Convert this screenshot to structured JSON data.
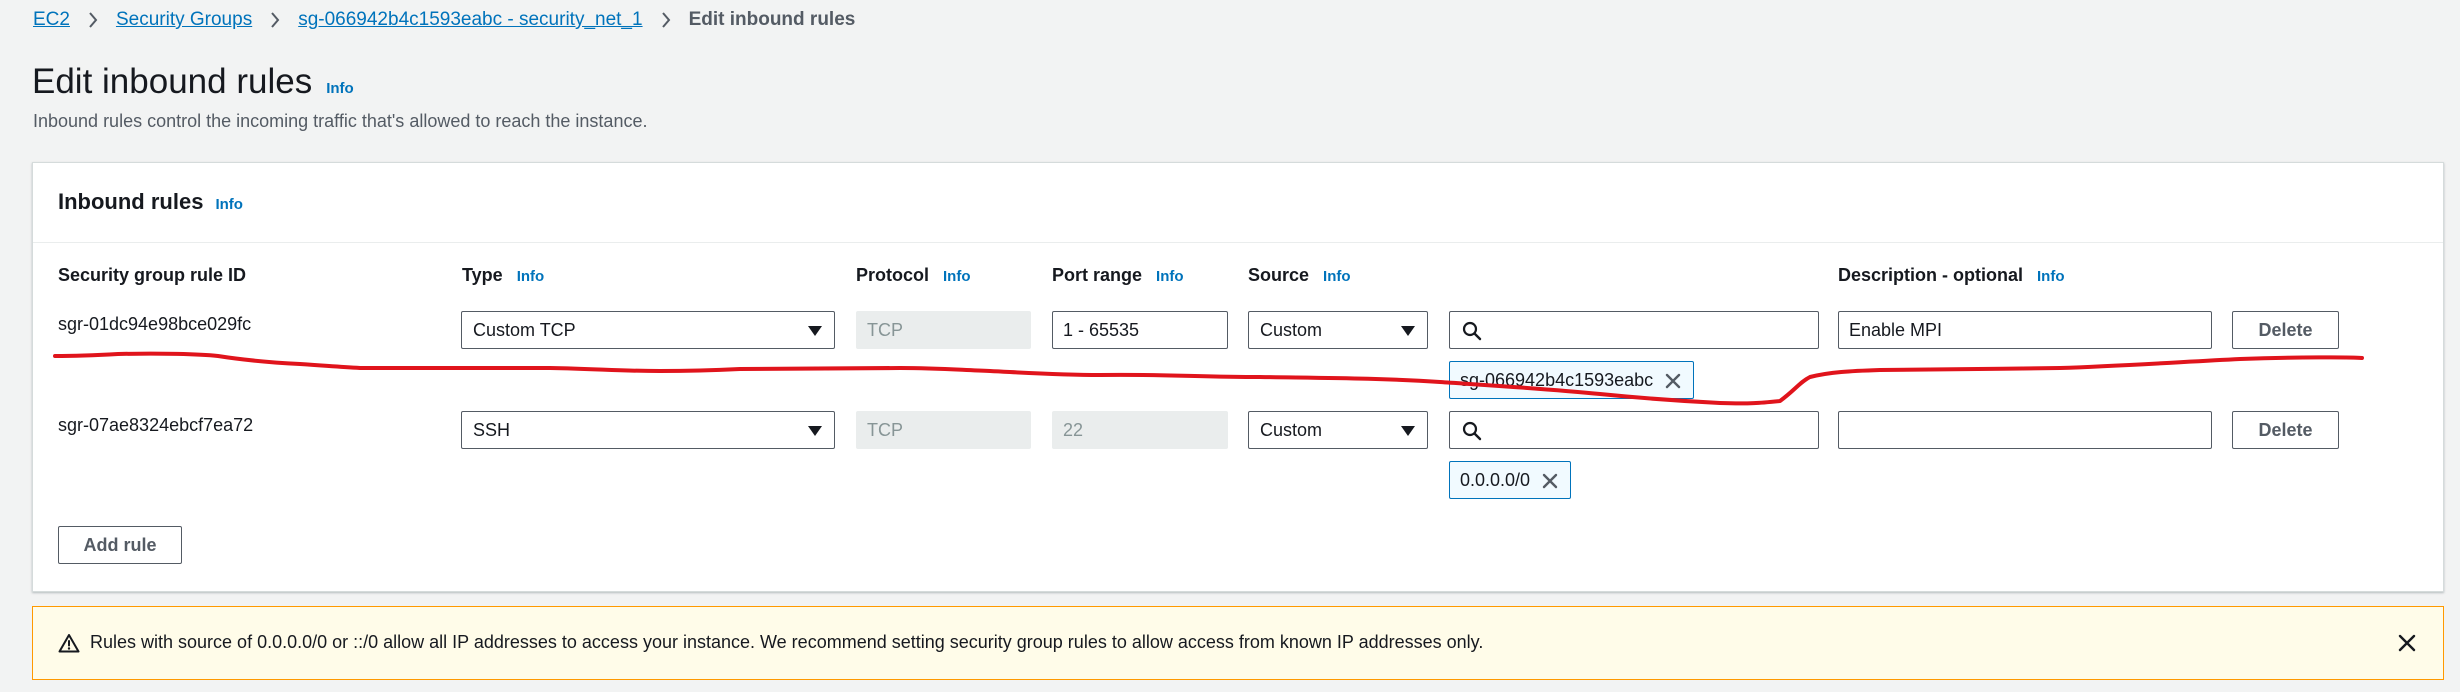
{
  "breadcrumb": {
    "items": [
      "EC2",
      "Security Groups",
      "sg-066942b4c1593eabc - security_net_1"
    ],
    "current": "Edit inbound rules"
  },
  "header": {
    "title": "Edit inbound rules",
    "info": "Info",
    "description": "Inbound rules control the incoming traffic that's allowed to reach the instance."
  },
  "panel": {
    "title": "Inbound rules",
    "info": "Info",
    "columns": {
      "rule_id": "Security group rule ID",
      "type": "Type",
      "protocol": "Protocol",
      "port_range": "Port range",
      "source": "Source",
      "description": "Description - optional",
      "info": "Info"
    },
    "rules": [
      {
        "id": "sgr-01dc94e98bce029fc",
        "type": "Custom TCP",
        "protocol": "TCP",
        "port_range": "1 - 65535",
        "source": "Custom",
        "search_value": "",
        "token": "sg-066942b4c1593eabc",
        "description": "Enable MPI",
        "delete_label": "Delete"
      },
      {
        "id": "sgr-07ae8324ebcf7ea72",
        "type": "SSH",
        "protocol": "TCP",
        "port_range": "22",
        "source": "Custom",
        "search_value": "",
        "token": "0.0.0.0/0",
        "description": "",
        "delete_label": "Delete"
      }
    ],
    "add_rule_label": "Add rule"
  },
  "alert": {
    "text": "Rules with source of 0.0.0.0/0 or ::/0 allow all IP addresses to access your instance. We recommend setting security group rules to allow access from known IP addresses only."
  },
  "colors": {
    "link": "#0073bb",
    "annotation": "#e0141c",
    "warning_bg": "#fffce9",
    "warning_border": "#ff9900"
  }
}
